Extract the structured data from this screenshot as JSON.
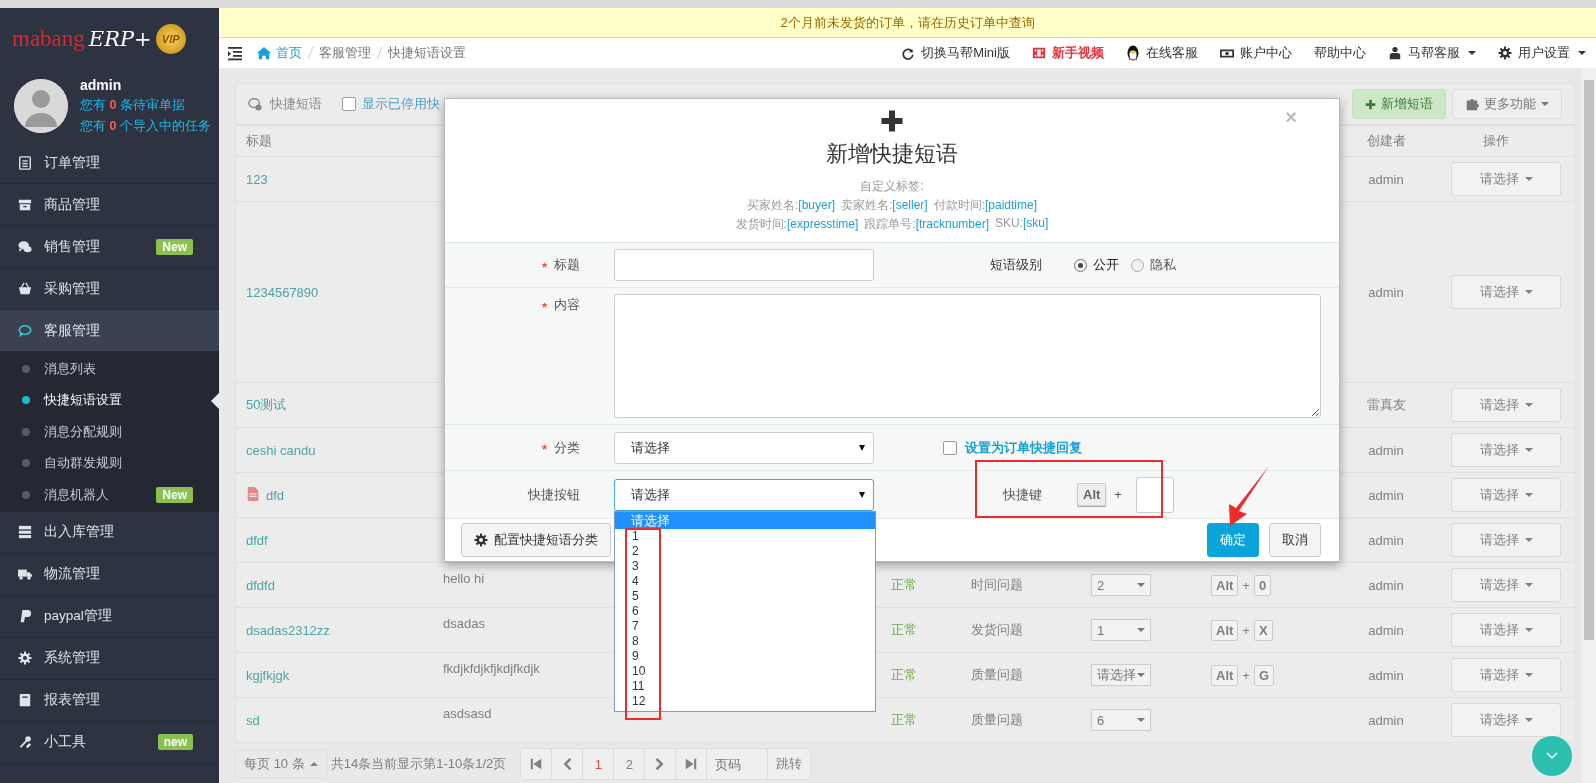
{
  "sidebar": {
    "logo": {
      "brand": "mabang",
      "product": "ERP+",
      "badge": "VIP"
    },
    "user": {
      "name": "admin",
      "lines": [
        "您有 **0** 条待审单据",
        "您有 **0** 个导入中的任务"
      ]
    },
    "menu": [
      {
        "label": "订单管理",
        "expanded": false
      },
      {
        "label": "商品管理",
        "expanded": false
      },
      {
        "label": "销售管理",
        "expanded": false,
        "badge": "New"
      },
      {
        "label": "采购管理",
        "expanded": false
      },
      {
        "label": "客服管理",
        "expanded": true,
        "children": [
          {
            "label": "消息列表",
            "selected": false
          },
          {
            "label": "快捷短语设置",
            "selected": true
          },
          {
            "label": "消息分配规则",
            "selected": false
          },
          {
            "label": "自动群发规则",
            "selected": false
          },
          {
            "label": "消息机器人",
            "selected": false,
            "badge": "New"
          }
        ]
      },
      {
        "label": "出入库管理",
        "expanded": false
      },
      {
        "label": "物流管理",
        "expanded": false
      },
      {
        "label": "paypal管理",
        "expanded": false
      },
      {
        "label": "系统管理",
        "expanded": false
      },
      {
        "label": "报表管理",
        "expanded": false
      },
      {
        "label": "小工具",
        "expanded": false,
        "badge": "new"
      }
    ]
  },
  "notice": "2个月前未发货的订单，请在历史订单中查询",
  "header": {
    "breadcrumbs": [
      "首页",
      "客服管理",
      "快捷短语设置"
    ],
    "links": [
      {
        "label": "切换马帮Mini版",
        "kind": "link",
        "dropdown": false
      },
      {
        "label": "新手视频",
        "kind": "promo",
        "dropdown": false
      },
      {
        "label": "在线客服",
        "kind": "link",
        "dropdown": false
      },
      {
        "label": "账户中心",
        "kind": "link",
        "dropdown": false
      },
      {
        "label": "帮助中心",
        "kind": "link",
        "dropdown": false
      },
      {
        "label": "马帮客服",
        "kind": "link",
        "dropdown": true
      },
      {
        "label": "用户设置",
        "kind": "link",
        "dropdown": true
      }
    ]
  },
  "toolbar": {
    "title": "快捷短语",
    "show_disabled": {
      "label": "显示已停用快",
      "checked": false
    },
    "buttons": [
      {
        "label": "新增短语",
        "kind": "add"
      },
      {
        "label": "更多功能",
        "kind": "more"
      }
    ]
  },
  "table": {
    "columns": {
      "title": "标题",
      "creator": "创建者",
      "action": "操作"
    },
    "rows": [
      {
        "title": "123",
        "document": false,
        "creator": "admin",
        "action": "请选择"
      },
      {
        "title": "1234567890",
        "document": false,
        "creator": "admin",
        "action": "请选择"
      },
      {
        "title": "50测试",
        "document": false,
        "creator": "雷真友",
        "action": "请选择"
      },
      {
        "title": "ceshi candu",
        "document": false,
        "creator": "admin",
        "action": "请选择"
      },
      {
        "title": "dfd",
        "document": true,
        "creator": "admin",
        "action": "请选择"
      },
      {
        "title": "dfdf",
        "document": false,
        "creator": "admin",
        "action": "请选择"
      },
      {
        "title": "dfdfd",
        "document": false,
        "content": "hello hi",
        "status": "正常",
        "category": "时间问题",
        "button": "2",
        "shortcut": {
          "modifier": "Alt",
          "joiner": "+",
          "key": "0"
        },
        "creator": "admin",
        "action": "请选择"
      },
      {
        "title": "dsadas2312zz",
        "document": false,
        "content": "dsadas",
        "status": "正常",
        "category": "发货问题",
        "button": "1",
        "shortcut": {
          "modifier": "Alt",
          "joiner": "+",
          "key": "X"
        },
        "creator": "admin",
        "action": "请选择"
      },
      {
        "title": "kgjfkjgk",
        "document": false,
        "content": "fkdjkfdjkfjkdjfkdjk",
        "status": "正常",
        "category": "质量问题",
        "button": "请选择",
        "shortcut": {
          "modifier": "Alt",
          "joiner": "+",
          "key": "G"
        },
        "creator": "admin",
        "action": "请选择"
      },
      {
        "title": "sd",
        "document": false,
        "content": "asdsasd",
        "status": "正常",
        "category": "质量问题",
        "button": "6",
        "creator": "admin",
        "action": "请选择"
      }
    ]
  },
  "pagination": {
    "page_size": {
      "label": "每页",
      "value": "10",
      "unit": "条"
    },
    "summary": "共14条当前显示第1-10条1/2页",
    "pages": [
      {
        "label": "1",
        "selected": true
      },
      {
        "label": "2",
        "selected": false
      }
    ],
    "page_input": {
      "placeholder": "页码"
    },
    "go": "跳转"
  },
  "modal": {
    "close": "×",
    "title": "新增快捷短语",
    "tags_heading": "自定义标签:",
    "tag_lines": [
      [
        {
          "label": "买家姓名:",
          "token": "[buyer]"
        },
        {
          "label": "卖家姓名:",
          "token": "[seller]"
        },
        {
          "label": "付款时间:",
          "token": "[paidtime]"
        }
      ],
      [
        {
          "label": "发货时间:",
          "token": "[expresstime]"
        },
        {
          "label": "跟踪单号:",
          "token": "[tracknumber]"
        },
        {
          "label": "SKU:",
          "token": "[sku]"
        }
      ]
    ],
    "title_field": {
      "label": "标题",
      "required": true
    },
    "level": {
      "label": "短语级别",
      "options": [
        {
          "label": "公开",
          "selected": true
        },
        {
          "label": "隐私",
          "selected": false
        }
      ]
    },
    "content": {
      "label": "内容",
      "required": true
    },
    "category": {
      "label": "分类",
      "required": true,
      "value": "请选择"
    },
    "order_reply": {
      "label": "设置为订单快捷回复",
      "checked": false
    },
    "button_select": {
      "label": "快捷按钮",
      "required": false,
      "value": "请选择",
      "expanded": true,
      "options": [
        {
          "label": "请选择",
          "selected": true
        },
        {
          "label": "1",
          "selected": false
        },
        {
          "label": "2",
          "selected": false
        },
        {
          "label": "3",
          "selected": false
        },
        {
          "label": "4",
          "selected": false
        },
        {
          "label": "5",
          "selected": false
        },
        {
          "label": "6",
          "selected": false
        },
        {
          "label": "7",
          "selected": false
        },
        {
          "label": "8",
          "selected": false
        },
        {
          "label": "9",
          "selected": false
        },
        {
          "label": "10",
          "selected": false
        },
        {
          "label": "11",
          "selected": false
        },
        {
          "label": "12",
          "selected": false
        }
      ]
    },
    "hotkey": {
      "label": "快捷键",
      "modifier": "Alt",
      "joiner": "+"
    },
    "footer": {
      "config": "配置快捷短语分类",
      "confirm": "确定",
      "cancel": "取消"
    }
  }
}
